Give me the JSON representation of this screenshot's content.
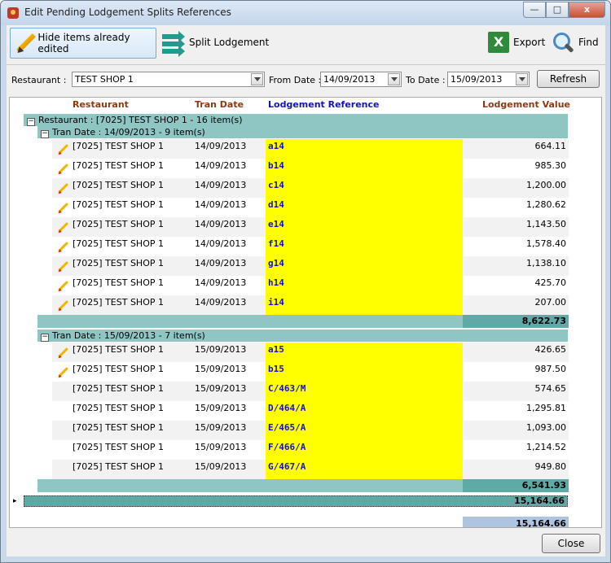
{
  "window": {
    "title": "Edit Pending Lodgement Splits References",
    "min": "—",
    "max": "□",
    "close": "x"
  },
  "toolbar": {
    "hide_label": "Hide items already edited",
    "split_label": "Split Lodgement",
    "export_label": "Export",
    "find_label": "Find"
  },
  "filters": {
    "restaurant_label": "Restaurant :",
    "restaurant_value": "TEST SHOP 1",
    "from_label": "From Date :",
    "from_value": "14/09/2013",
    "to_label": "To Date :",
    "to_value": "15/09/2013",
    "refresh_label": "Refresh"
  },
  "columns": {
    "restaurant": "Restaurant",
    "tran_date": "Tran Date",
    "reference": "Lodgement Reference",
    "value": "Lodgement Value"
  },
  "restaurant_group": "Restaurant : [7025] TEST SHOP 1 - 16 item(s)",
  "groups": [
    {
      "header": "Tran Date : 14/09/2013 - 9 item(s)",
      "total": "8,622.73",
      "rows": [
        {
          "restaurant": "[7025] TEST SHOP 1",
          "date": "14/09/2013",
          "ref": "a14",
          "value": "664.11",
          "edited": true
        },
        {
          "restaurant": "[7025] TEST SHOP 1",
          "date": "14/09/2013",
          "ref": "b14",
          "value": "985.30",
          "edited": true
        },
        {
          "restaurant": "[7025] TEST SHOP 1",
          "date": "14/09/2013",
          "ref": "c14",
          "value": "1,200.00",
          "edited": true
        },
        {
          "restaurant": "[7025] TEST SHOP 1",
          "date": "14/09/2013",
          "ref": "d14",
          "value": "1,280.62",
          "edited": true
        },
        {
          "restaurant": "[7025] TEST SHOP 1",
          "date": "14/09/2013",
          "ref": "e14",
          "value": "1,143.50",
          "edited": true
        },
        {
          "restaurant": "[7025] TEST SHOP 1",
          "date": "14/09/2013",
          "ref": "f14",
          "value": "1,578.40",
          "edited": true
        },
        {
          "restaurant": "[7025] TEST SHOP 1",
          "date": "14/09/2013",
          "ref": "g14",
          "value": "1,138.10",
          "edited": true
        },
        {
          "restaurant": "[7025] TEST SHOP 1",
          "date": "14/09/2013",
          "ref": "h14",
          "value": "425.70",
          "edited": true
        },
        {
          "restaurant": "[7025] TEST SHOP 1",
          "date": "14/09/2013",
          "ref": "i14",
          "value": "207.00",
          "edited": true
        }
      ]
    },
    {
      "header": "Tran Date : 15/09/2013 - 7 item(s)",
      "total": "6,541.93",
      "rows": [
        {
          "restaurant": "[7025] TEST SHOP 1",
          "date": "15/09/2013",
          "ref": "a15",
          "value": "426.65",
          "edited": true
        },
        {
          "restaurant": "[7025] TEST SHOP 1",
          "date": "15/09/2013",
          "ref": "b15",
          "value": "987.50",
          "edited": true
        },
        {
          "restaurant": "[7025] TEST SHOP 1",
          "date": "15/09/2013",
          "ref": "C/463/M",
          "value": "574.65",
          "edited": false
        },
        {
          "restaurant": "[7025] TEST SHOP 1",
          "date": "15/09/2013",
          "ref": "D/464/A",
          "value": "1,295.81",
          "edited": false
        },
        {
          "restaurant": "[7025] TEST SHOP 1",
          "date": "15/09/2013",
          "ref": "E/465/A",
          "value": "1,093.00",
          "edited": false
        },
        {
          "restaurant": "[7025] TEST SHOP 1",
          "date": "15/09/2013",
          "ref": "F/466/A",
          "value": "1,214.52",
          "edited": false
        },
        {
          "restaurant": "[7025] TEST SHOP 1",
          "date": "15/09/2013",
          "ref": "G/467/A",
          "value": "949.80",
          "edited": false
        }
      ]
    }
  ],
  "restaurant_total": "15,164.66",
  "grand_total": "15,164.66",
  "footer": {
    "close_label": "Close"
  },
  "colors": {
    "group_band": "#8fc6c4",
    "reference_bg": "#ffff00",
    "reference_text": "#1414b4",
    "header_text": "#8b3a10"
  }
}
